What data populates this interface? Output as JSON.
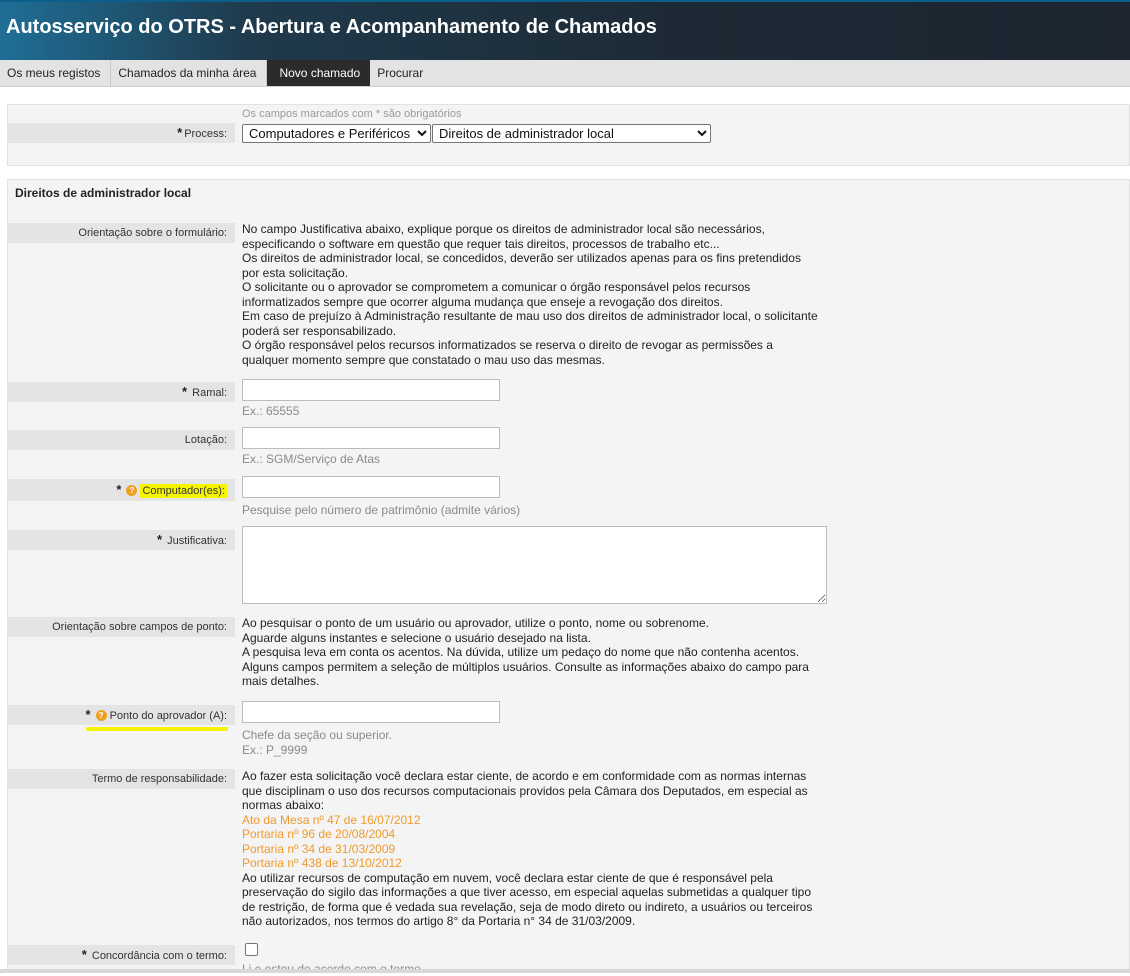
{
  "header": {
    "title": "Autosserviço do OTRS - Abertura e Acompanhamento de Chamados"
  },
  "nav": {
    "items": [
      {
        "label": "Os meus registos"
      },
      {
        "label": "Chamados da minha área"
      },
      {
        "label": "Novo chamado",
        "active": true
      },
      {
        "label": "Procurar"
      }
    ]
  },
  "process_box": {
    "required_note": "Os campos marcados com * são obrigatórios",
    "process_label": "Process:",
    "process_select_1": "Computadores e Periféricos",
    "process_select_2": "Direitos de administrador local"
  },
  "form": {
    "section_title": "Direitos de administrador local",
    "orientation_label": "Orientação sobre o formulário:",
    "orientation_lines": [
      "No campo Justificativa abaixo, explique porque os direitos de administrador local são necessários,",
      "especificando o software em questão que requer tais direitos, processos de trabalho etc...",
      "Os direitos de administrador local, se concedidos, deverão ser utilizados apenas para os fins pretendidos",
      "por esta solicitação.",
      "O solicitante ou o aprovador se comprometem a comunicar o órgão responsável pelos recursos",
      "informatizados sempre que ocorrer alguma mudança que enseje a revogação dos direitos.",
      "Em caso de prejuízo à Administração resultante de mau uso dos direitos de administrador local, o solicitante",
      "poderá ser responsabilizado.",
      "O órgão responsável pelos recursos informatizados se reserva o direito de revogar as permissões a",
      "qualquer momento sempre que constatado o mau uso das mesmas."
    ],
    "ramal_label": "Ramal:",
    "ramal_hint": "Ex.: 65555",
    "lotacao_label": "Lotação:",
    "lotacao_hint": "Ex.: SGM/Serviço de Atas",
    "computador_label": "Computador(es):",
    "computador_hint": "Pesquise pelo número de patrimônio (admite vários)",
    "justificativa_label": "Justificativa:",
    "ponto_orientation_label": "Orientação sobre campos de ponto:",
    "ponto_orientation_lines": [
      "Ao pesquisar o ponto de um usuário ou aprovador, utilize o ponto, nome ou sobrenome.",
      "Aguarde alguns instantes e selecione o usuário desejado na lista.",
      "A pesquisa leva em conta os acentos. Na dúvida, utilize um pedaço do nome que não contenha acentos.",
      "Alguns campos permitem a seleção de múltiplos usuários. Consulte as informações abaixo do campo para",
      "mais detalhes."
    ],
    "aprovador_label": "Ponto do aprovador (A):",
    "aprovador_hint_1": "Chefe da seção ou superior.",
    "aprovador_hint_2": "Ex.: P_9999",
    "termo_label": "Termo de responsabilidade:",
    "termo_intro_lines": [
      "Ao fazer esta solicitação você declara estar ciente, de acordo e em conformidade com as normas internas",
      "que disciplinam o uso dos recursos computacionais providos pela Câmara dos Deputados, em especial as",
      "normas abaixo:"
    ],
    "termo_links": [
      "Ato da Mesa nº 47 de 16/07/2012",
      "Portaria nº 96 de 20/08/2004",
      "Portaria nº 34 de 31/03/2009",
      "Portaria nº 438 de 13/10/2012"
    ],
    "termo_outro_lines": [
      "Ao utilizar recursos de computação em nuvem, você declara estar ciente de que é responsável pela",
      "preservação do sigilo das informações a que tiver acesso, em especial aquelas submetidas a qualquer tipo",
      "de restrição, de forma que é vedada sua revelação, seja de modo direto ou indireto, a usuários ou terceiros",
      "não autorizados, nos termos do artigo 8° da Portaria n° 34 de 31/03/2009."
    ],
    "concordancia_label": "Concordância com o termo:",
    "concordancia_hint": "Li e estou de acordo com o termo."
  },
  "colors": {
    "highlight": "#f5f500",
    "link": "#f09a2c",
    "help_icon": "#f0a020"
  }
}
